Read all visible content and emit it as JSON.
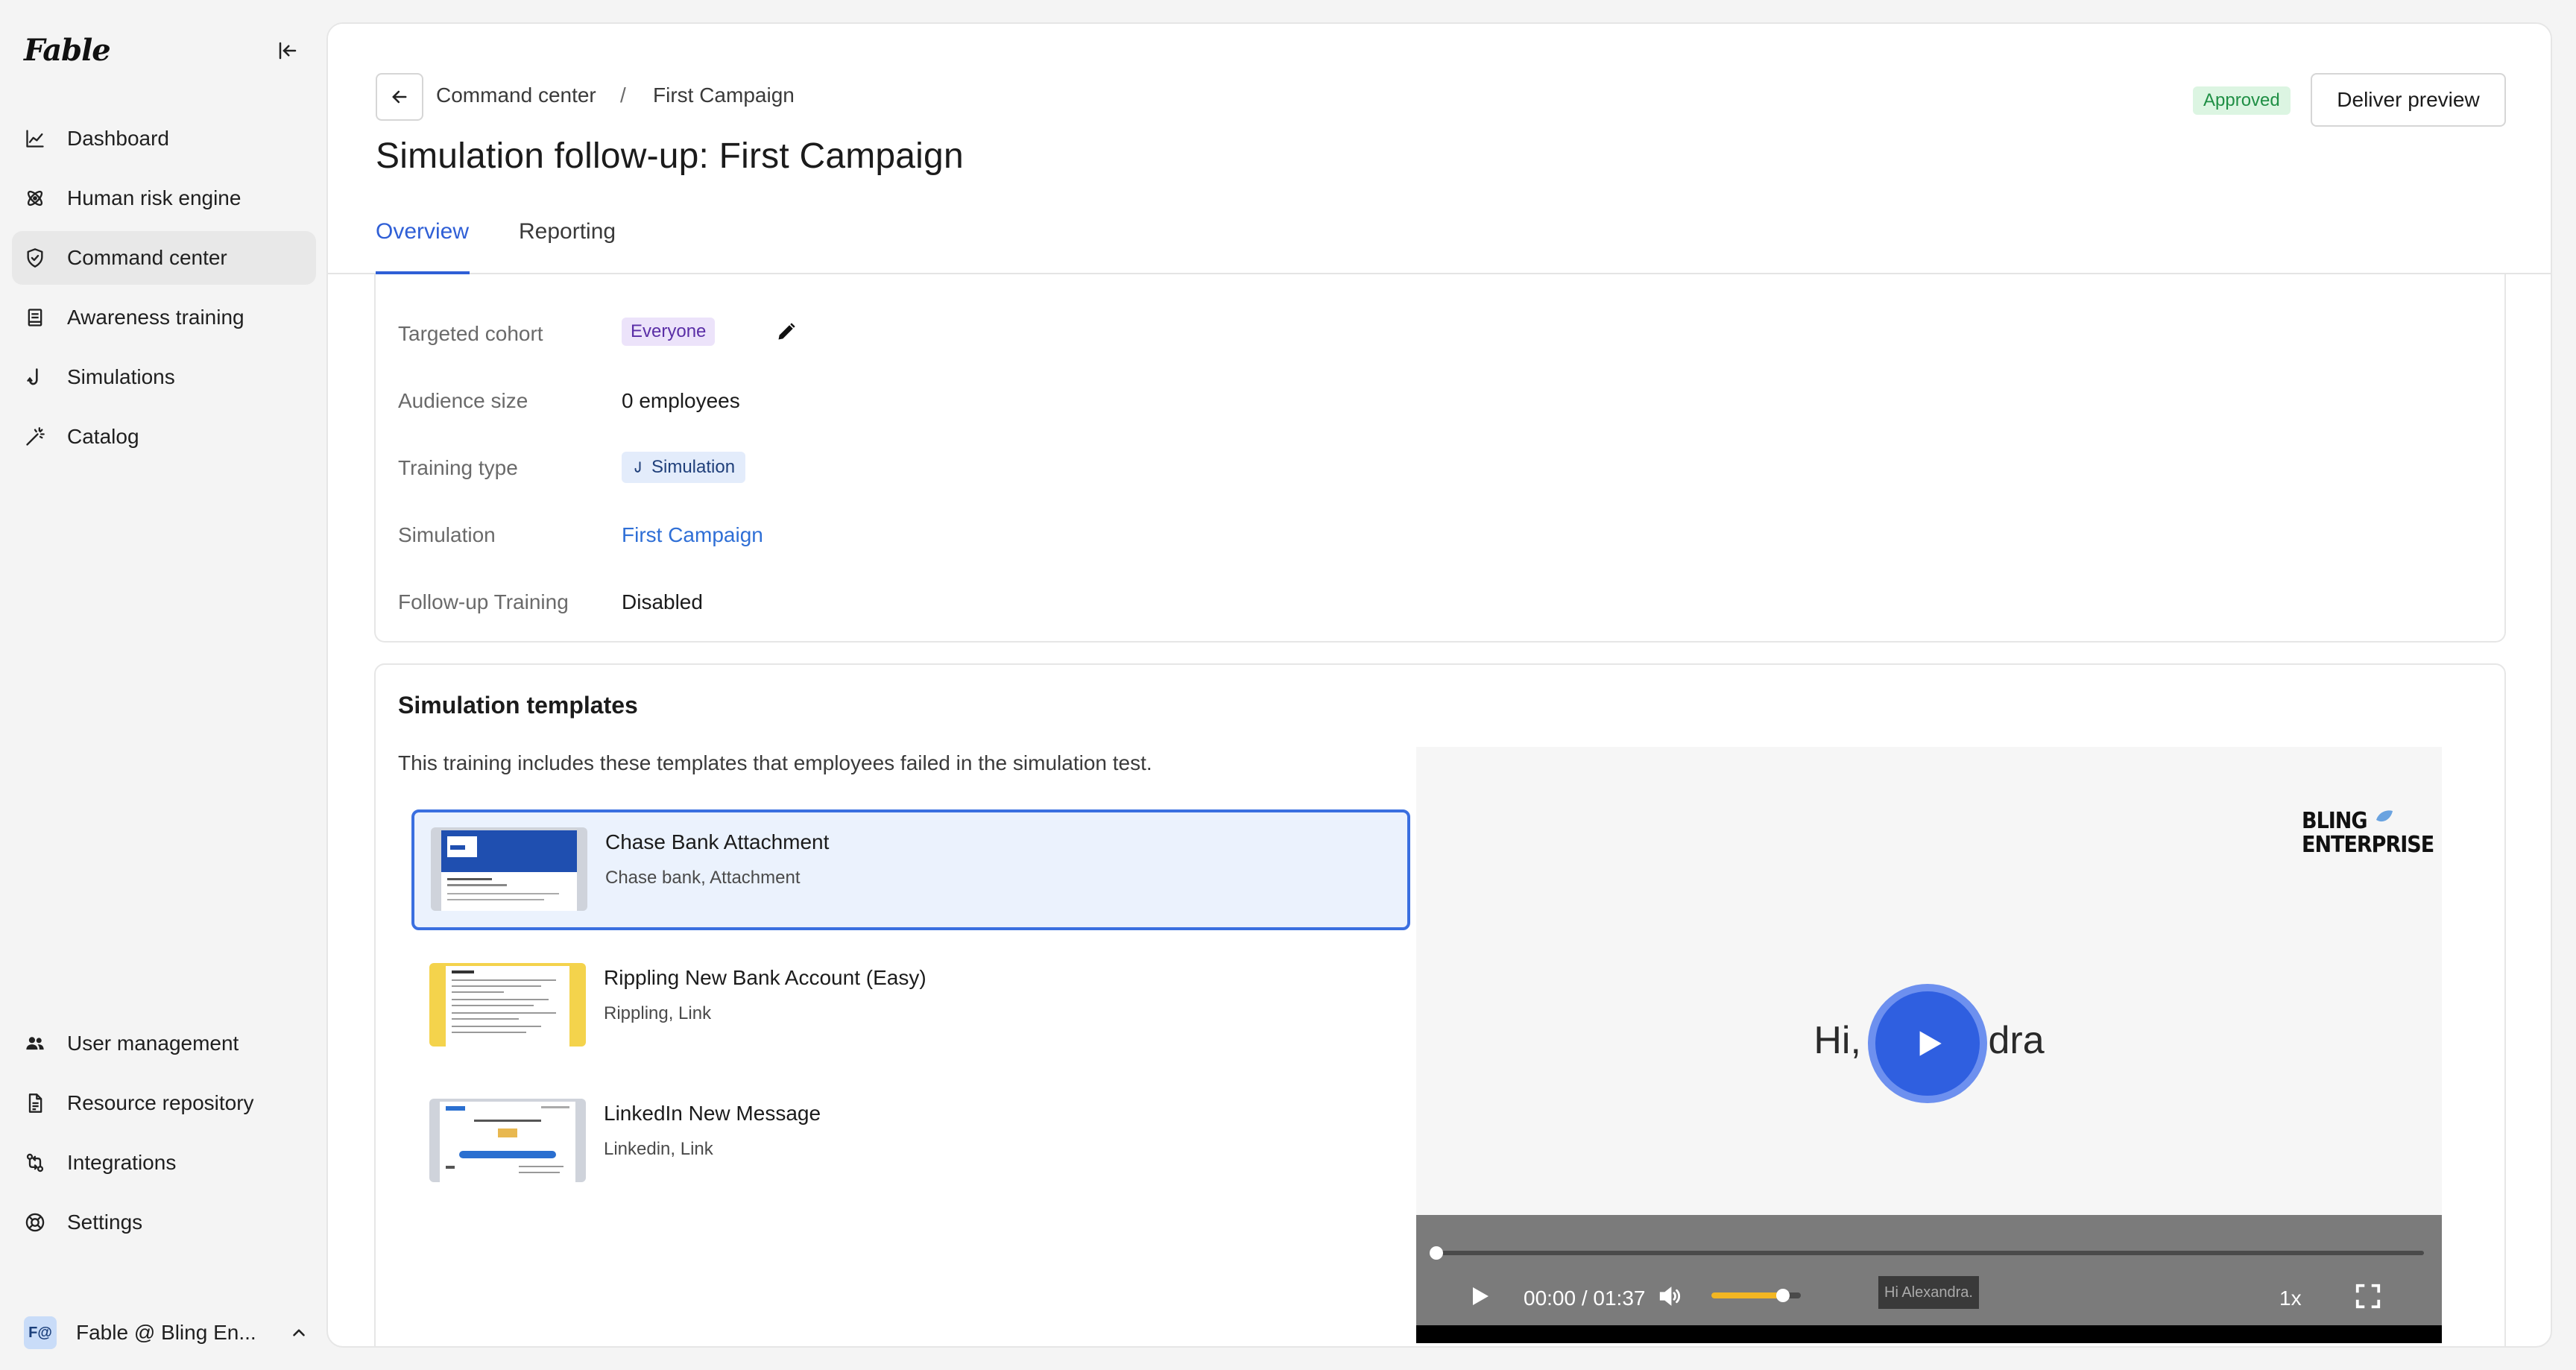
{
  "app": {
    "brand": "Fable"
  },
  "sidebar": {
    "top_items": [
      {
        "label": "Dashboard",
        "icon": "chart-line-icon"
      },
      {
        "label": "Human risk engine",
        "icon": "atom-icon"
      },
      {
        "label": "Command center",
        "icon": "shield-check-icon",
        "active": true
      },
      {
        "label": "Awareness training",
        "icon": "book-icon"
      },
      {
        "label": "Simulations",
        "icon": "fishhook-icon"
      },
      {
        "label": "Catalog",
        "icon": "magic-wand-icon"
      }
    ],
    "bottom_items": [
      {
        "label": "User management",
        "icon": "users-icon"
      },
      {
        "label": "Resource repository",
        "icon": "document-icon"
      },
      {
        "label": "Integrations",
        "icon": "git-compare-icon"
      },
      {
        "label": "Settings",
        "icon": "lifebuoy-icon"
      }
    ],
    "account": {
      "avatar": "F@",
      "name": "Fable @ Bling En..."
    }
  },
  "header": {
    "breadcrumb": [
      "Command center",
      "First Campaign"
    ],
    "breadcrumb_sep": "/",
    "title": "Simulation follow-up: First Campaign",
    "status": "Approved",
    "deliver_label": "Deliver preview",
    "tabs": [
      {
        "label": "Overview",
        "active": true
      },
      {
        "label": "Reporting",
        "active": false
      }
    ]
  },
  "details": {
    "targeted_cohort": {
      "label": "Targeted cohort",
      "value": "Everyone"
    },
    "audience_size": {
      "label": "Audience size",
      "value": "0 employees"
    },
    "training_type": {
      "label": "Training type",
      "value": "Simulation"
    },
    "simulation": {
      "label": "Simulation",
      "value": "First Campaign"
    },
    "follow_up": {
      "label": "Follow-up Training",
      "value": "Disabled"
    }
  },
  "templates": {
    "title": "Simulation templates",
    "description": "This training includes these templates that employees failed in the simulation test.",
    "items": [
      {
        "name": "Chase Bank Attachment",
        "tags": "Chase bank, Attachment",
        "selected": true
      },
      {
        "name": "Rippling New Bank Account (Easy)",
        "tags": "Rippling, Link",
        "selected": false
      },
      {
        "name": "LinkedIn New Message",
        "tags": "Linkedin, Link",
        "selected": false
      }
    ]
  },
  "video": {
    "logo_line1": "BLING",
    "logo_line2": "ENTERPRISE",
    "greeting": "Hi, Alexandra",
    "time": "00:00 / 01:37",
    "progress": 0,
    "volume": 0.8,
    "caption": "Hi Alexandra.",
    "speed": "1x"
  },
  "colors": {
    "accent": "#2f5fd6",
    "approved_bg": "#dcf5e2",
    "approved_fg": "#1f8f45",
    "cohort_bg": "#ece3fa",
    "volume_fill": "#f2b623"
  }
}
